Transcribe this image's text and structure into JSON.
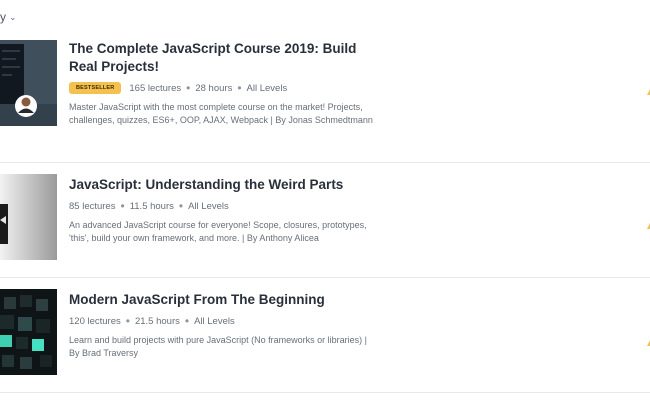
{
  "sort": {
    "label": "y",
    "chevron": "⌄"
  },
  "courses": [
    {
      "title": "The Complete JavaScript Course 2019: Build Real Projects!",
      "badge": "BESTSELLER",
      "lectures": "165 lectures",
      "hours": "28 hours",
      "level": "All Levels",
      "description": "Master JavaScript with the most complete course on the market! Projects, challenges, quizzes, ES6+, OOP, AJAX, Webpack | By Jonas Schmedtmann"
    },
    {
      "title": "JavaScript: Understanding the Weird Parts",
      "lectures": "85 lectures",
      "hours": "11.5 hours",
      "level": "All Levels",
      "description": "An advanced JavaScript course for everyone! Scope, closures, prototypes, 'this', build your own framework, and more. | By Anthony Alicea"
    },
    {
      "title": "Modern JavaScript From The Beginning",
      "lectures": "120 lectures",
      "hours": "21.5 hours",
      "level": "All Levels",
      "description": "Learn and build projects with pure JavaScript (No frameworks or libraries) | By Brad Traversy"
    }
  ],
  "colors": {
    "accent": "#f4c150",
    "title": "#29303b",
    "muted": "#686f7a"
  }
}
